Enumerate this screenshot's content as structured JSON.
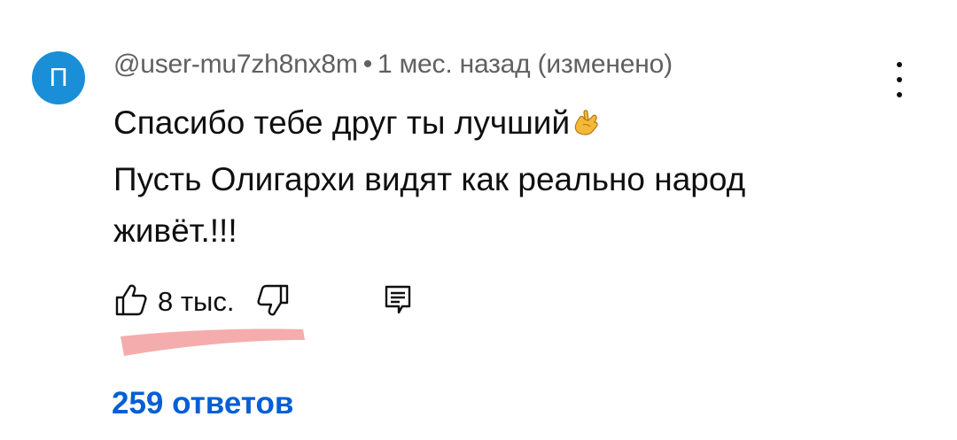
{
  "comment": {
    "avatar_letter": "П",
    "avatar_color": "#1a8fd8",
    "author": "@user-mu7zh8nx8m",
    "separator": "•",
    "timestamp": "1 мес. назад (изменено)",
    "text_lines": [
      "Спасибо тебе друг ты лучший",
      "Пусть Олигархи видят как реально народ",
      "живёт.!!!"
    ],
    "emoji": "hand-call-me-icon",
    "like_count": "8 тыс.",
    "replies_label": "259 ответов",
    "replies_color": "#065fd4"
  },
  "icons": {
    "more": "kebab-menu-icon",
    "like": "thumbs-up-icon",
    "dislike": "thumbs-down-icon",
    "reply": "reply-comment-icon"
  },
  "annotation": {
    "marker_color": "#f4a3a3"
  }
}
